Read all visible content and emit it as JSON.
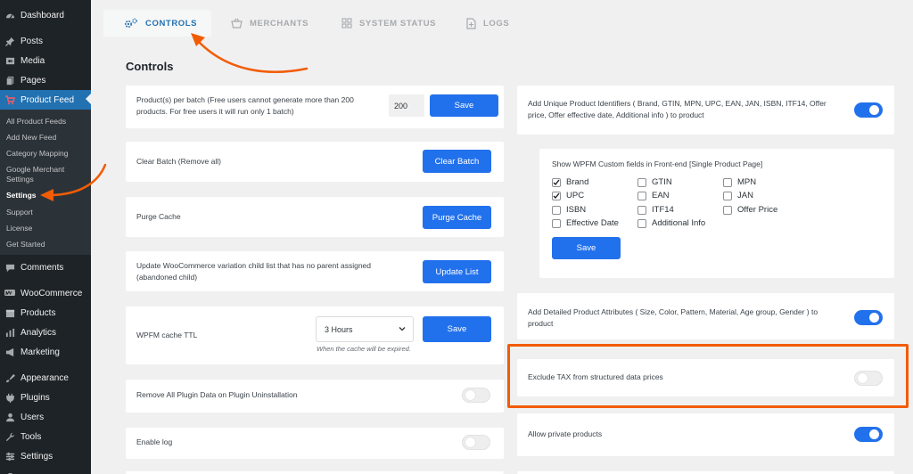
{
  "sidebar": {
    "items": [
      {
        "label": "Dashboard",
        "icon": "dashboard-icon"
      },
      {
        "label": "Posts",
        "icon": "pin-icon"
      },
      {
        "label": "Media",
        "icon": "media-icon"
      },
      {
        "label": "Pages",
        "icon": "pages-icon"
      },
      {
        "label": "Product Feed",
        "icon": "feed-icon"
      },
      {
        "label": "Comments",
        "icon": "comment-icon"
      },
      {
        "label": "WooCommerce",
        "icon": "woo-icon"
      },
      {
        "label": "Products",
        "icon": "box-icon"
      },
      {
        "label": "Analytics",
        "icon": "bar-chart-icon"
      },
      {
        "label": "Marketing",
        "icon": "megaphone-icon"
      },
      {
        "label": "Appearance",
        "icon": "brush-icon"
      },
      {
        "label": "Plugins",
        "icon": "plug-icon"
      },
      {
        "label": "Users",
        "icon": "user-icon"
      },
      {
        "label": "Tools",
        "icon": "wrench-icon"
      },
      {
        "label": "Settings",
        "icon": "settings-icon"
      }
    ],
    "submenu": [
      "All Product Feeds",
      "Add New Feed",
      "Category Mapping",
      "Google Merchant Settings",
      "Settings",
      "Support",
      "License",
      "Get Started"
    ]
  },
  "tabs": [
    {
      "label": "CONTROLS",
      "icon": "gear-icon"
    },
    {
      "label": "MERCHANTS",
      "icon": "basket-icon"
    },
    {
      "label": "SYSTEM STATUS",
      "icon": "grid-icon"
    },
    {
      "label": "LOGS",
      "icon": "file-icon"
    }
  ],
  "section_title": "Controls",
  "left": {
    "batch": {
      "label": "Product(s) per batch (Free users cannot generate more than 200 products. For free users it will run only 1 batch)",
      "value": "200",
      "button": "Save"
    },
    "clear_batch": {
      "label": "Clear Batch (Remove all)",
      "button": "Clear Batch"
    },
    "purge_cache": {
      "label": "Purge Cache",
      "button": "Purge Cache"
    },
    "update_list": {
      "label": "Update WooCommerce variation child list that has no parent assigned (abandoned child)",
      "button": "Update List"
    },
    "cache_ttl": {
      "label": "WPFM cache TTL",
      "selected": "3 Hours",
      "hint": "When the cache will be expired.",
      "button": "Save"
    },
    "remove_data": {
      "label": "Remove All Plugin Data on Plugin Uninstallation",
      "enabled": false
    },
    "enable_log": {
      "label": "Enable log",
      "enabled": false
    }
  },
  "right": {
    "unique_ids": {
      "label": "Add Unique Product Identifiers ( Brand, GTIN, MPN, UPC, EAN, JAN, ISBN, ITF14, Offer price, Offer effective date, Additional info ) to product",
      "enabled": true
    },
    "custom_fields": {
      "title": "Show WPFM Custom fields in Front-end [Single Product Page]",
      "fields": [
        {
          "label": "Brand",
          "checked": true
        },
        {
          "label": "GTIN",
          "checked": false
        },
        {
          "label": "MPN",
          "checked": false
        },
        {
          "label": "UPC",
          "checked": true
        },
        {
          "label": "EAN",
          "checked": false
        },
        {
          "label": "JAN",
          "checked": false
        },
        {
          "label": "ISBN",
          "checked": false
        },
        {
          "label": "ITF14",
          "checked": false
        },
        {
          "label": "Offer Price",
          "checked": false
        },
        {
          "label": "Effective Date",
          "checked": false
        },
        {
          "label": "Additional Info",
          "checked": false
        }
      ],
      "button": "Save"
    },
    "detailed_attrs": {
      "label": "Add Detailed Product Attributes ( Size, Color, Pattern, Material, Age group, Gender ) to product",
      "enabled": true
    },
    "exclude_tax": {
      "label": "Exclude TAX from structured data prices",
      "enabled": false
    },
    "private_products": {
      "label": "Allow private products",
      "enabled": true
    }
  },
  "colors": {
    "accent": "#2271ec",
    "annotation": "#f25c05",
    "sidebar_bg": "#1d2327",
    "sidebar_active": "#2271b1"
  }
}
